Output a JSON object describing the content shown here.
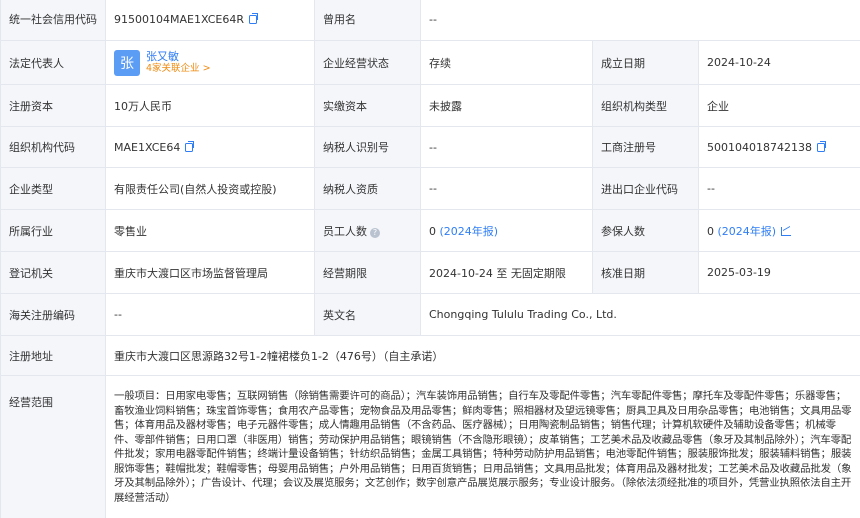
{
  "watermark": "企知道",
  "rows": {
    "credit_code": {
      "label": "统一社会信用代码",
      "value": "91500104MAE1XCE64R"
    },
    "former_name": {
      "label": "曾用名",
      "value": "--"
    },
    "legal_rep": {
      "label": "法定代表人",
      "avatar_char": "张",
      "name": "张又敏",
      "sub": "4家关联企业 >"
    },
    "biz_status": {
      "label": "企业经营状态",
      "value": "存续"
    },
    "est_date": {
      "label": "成立日期",
      "value": "2024-10-24"
    },
    "reg_capital": {
      "label": "注册资本",
      "value": "10万人民币"
    },
    "paid_capital": {
      "label": "实缴资本",
      "value": "未披露"
    },
    "org_type": {
      "label": "组织机构类型",
      "value": "企业"
    },
    "org_code": {
      "label": "组织机构代码",
      "value": "MAE1XCE64"
    },
    "taxpayer_id": {
      "label": "纳税人识别号",
      "value": "--"
    },
    "reg_no": {
      "label": "工商注册号",
      "value": "500104018742138"
    },
    "company_type": {
      "label": "企业类型",
      "value": "有限责任公司(自然人投资或控股)"
    },
    "taxpayer_qual": {
      "label": "纳税人资质",
      "value": "--"
    },
    "ie_code": {
      "label": "进出口企业代码",
      "value": "--"
    },
    "industry": {
      "label": "所属行业",
      "value": "零售业"
    },
    "staff": {
      "label": "员工人数",
      "value": "0",
      "link": "(2024年报)"
    },
    "insured": {
      "label": "参保人数",
      "value": "0",
      "link": "(2024年报)"
    },
    "reg_authority": {
      "label": "登记机关",
      "value": "重庆市大渡口区市场监督管理局"
    },
    "biz_term": {
      "label": "经营期限",
      "value": "2024-10-24 至 无固定期限"
    },
    "approval_date": {
      "label": "核准日期",
      "value": "2025-03-19"
    },
    "customs_code": {
      "label": "海关注册编码",
      "value": "--"
    },
    "english_name": {
      "label": "英文名",
      "value": "Chongqing Tululu Trading Co., Ltd."
    },
    "address": {
      "label": "注册地址",
      "value": "重庆市大渡口区思源路32号1-2幢裙楼负1-2（476号）（自主承诺）"
    },
    "scope": {
      "label": "经营范围",
      "value": "一般项目：日用家电零售；互联网销售（除销售需要许可的商品）；汽车装饰用品销售；自行车及零配件零售；汽车零配件零售；摩托车及零配件零售；乐器零售；畜牧渔业饲料销售；珠宝首饰零售；食用农产品零售；宠物食品及用品零售；鲜肉零售；照相器材及望远镜零售；厨具卫具及日用杂品零售；电池销售；文具用品零售；体育用品及器材零售；电子元器件零售；成人情趣用品销售（不含药品、医疗器械）；日用陶瓷制品销售；销售代理；计算机软硬件及辅助设备零售；机械零件、零部件销售；日用口罩（非医用）销售；劳动保护用品销售；眼镜销售（不含隐形眼镜）；皮革销售；工艺美术品及收藏品零售（象牙及其制品除外）；汽车零配件批发；家用电器零配件销售；终端计量设备销售；针纺织品销售；金属工具销售；特种劳动防护用品销售；电池零配件销售；服装服饰批发；服装辅料销售；服装服饰零售；鞋帽批发；鞋帽零售；母婴用品销售；户外用品销售；日用百货销售；日用品销售；文具用品批发；体育用品及器材批发；工艺美术品及收藏品批发（象牙及其制品除外）；广告设计、代理；会议及展览服务；文艺创作；数字创意产品展览展示服务；专业设计服务。（除依法须经批准的项目外，凭营业执照依法自主开展经营活动）"
    }
  }
}
